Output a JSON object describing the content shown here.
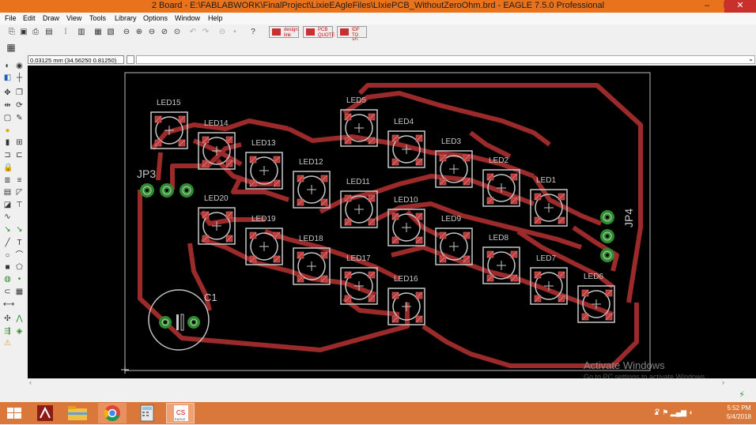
{
  "window": {
    "title": "2 Board - E:\\FABLABWORK\\FinalProject\\LixieEAgleFiles\\LIxiePCB_WithoutZeroOhm.brd - EAGLE 7.5.0 Professional",
    "minimize": "‒",
    "maximize": "❐",
    "close": "✕"
  },
  "menu": [
    "File",
    "Edit",
    "Draw",
    "View",
    "Tools",
    "Library",
    "Options",
    "Window",
    "Help"
  ],
  "toolbar": {
    "icons": [
      "open-icon",
      "save-icon",
      "print-icon",
      "cam-icon",
      "schematic-icon",
      "board-icon",
      "script-icon",
      "run-icon",
      "zoom-fit-icon",
      "zoom-in-icon",
      "zoom-out-icon",
      "zoom-redraw-icon",
      "zoom-select-icon",
      "undo-icon",
      "redo-icon",
      "stop-icon",
      "go-icon",
      "help-icon"
    ],
    "designlink": "design link",
    "pcb_quote": "PCB QUOTE",
    "idf": "IDF TO 3D"
  },
  "coordinates": "0.03125 mm (34.56250 0.81250)",
  "board": {
    "leds": [
      {
        "label": "LED15"
      },
      {
        "label": "LED14"
      },
      {
        "label": "LED13"
      },
      {
        "label": "LED12"
      },
      {
        "label": "LED11"
      },
      {
        "label": "LED5"
      },
      {
        "label": "LED4"
      },
      {
        "label": "LED3"
      },
      {
        "label": "LED2"
      },
      {
        "label": "LED1"
      },
      {
        "label": "LED20"
      },
      {
        "label": "LED19"
      },
      {
        "label": "LED18"
      },
      {
        "label": "LED17"
      },
      {
        "label": "LED16"
      },
      {
        "label": "LED10"
      },
      {
        "label": "LED9"
      },
      {
        "label": "LED8"
      },
      {
        "label": "LED7"
      },
      {
        "label": "LED6"
      }
    ],
    "connector_left": "JP3",
    "connector_right": "JP4",
    "capacitor": "C1"
  },
  "watermark": {
    "line1": "Activate Windows",
    "line2": "Go to PC settings to activate Windows."
  },
  "taskbar": {
    "apps": [
      "windows-start-icon",
      "acrobat-icon",
      "file-explorer-icon",
      "chrome-icon",
      "calculator-icon",
      "eagle-icon"
    ],
    "time": "5:52 PM",
    "date": "5/4/2018"
  },
  "colors": {
    "trace": "#9b2a2a",
    "pad": "#b73b3b",
    "via_green": "#2c8c2c",
    "silkscreen": "#c8c8c8",
    "titlebar": "#e8731c",
    "taskbar": "#d9783a"
  }
}
